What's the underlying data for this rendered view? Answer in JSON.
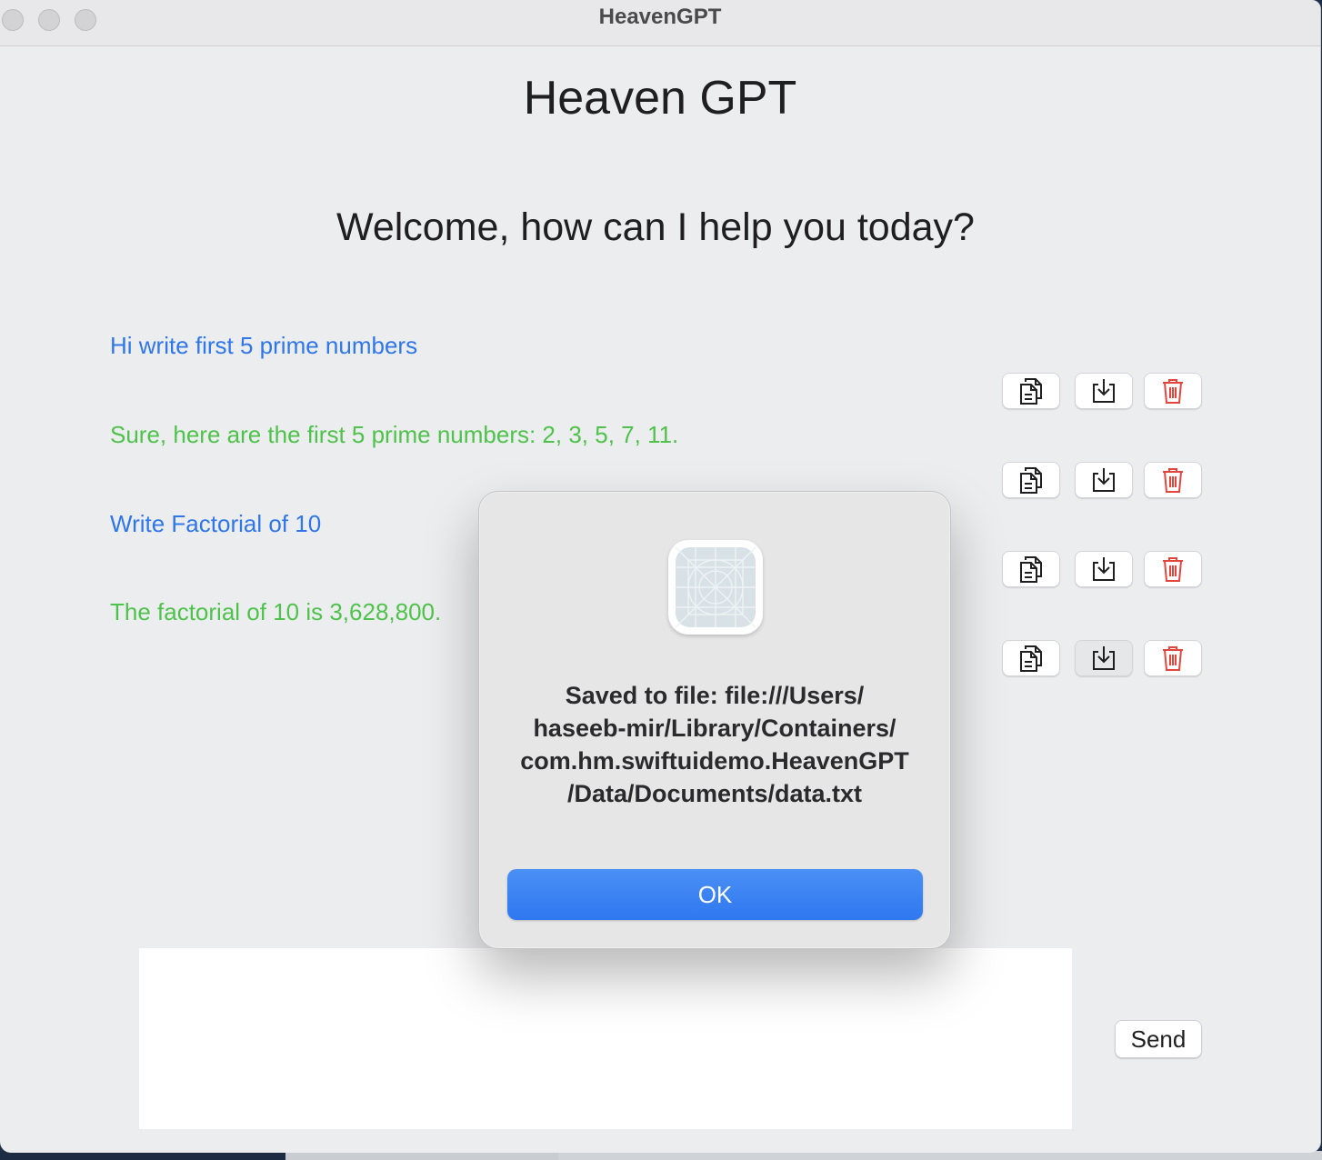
{
  "window": {
    "title": "HeavenGPT"
  },
  "app": {
    "heading": "Heaven GPT",
    "welcome": "Welcome, how can I help you today?"
  },
  "messages": [
    {
      "role": "user",
      "text": "Hi write first 5 prime numbers",
      "color": "#2f76e8"
    },
    {
      "role": "assistant",
      "text": "Sure, here are the first 5 prime numbers: 2, 3, 5, 7, 11.",
      "color": "#4fc24b"
    },
    {
      "role": "user",
      "text": "Write Factorial of 10",
      "color": "#2f76e8"
    },
    {
      "role": "assistant",
      "text": "The factorial of 10 is 3,628,800.",
      "color": "#4fc24b"
    }
  ],
  "row_actions": {
    "copy_icon": "copy-icon",
    "save_icon": "download-icon",
    "delete_icon": "trash-icon",
    "delete_color": "#e2453c"
  },
  "composer": {
    "input_value": "",
    "send_label": "Send"
  },
  "alert": {
    "icon": "app-placeholder-icon",
    "message": "Saved to file: file:///Users/\nhaseeb-mir/Library/Containers/\ncom.hm.swiftuidemo.HeavenGPT\n/Data/Documents/data.txt",
    "ok_label": "OK",
    "accent": "#2f78f0"
  }
}
